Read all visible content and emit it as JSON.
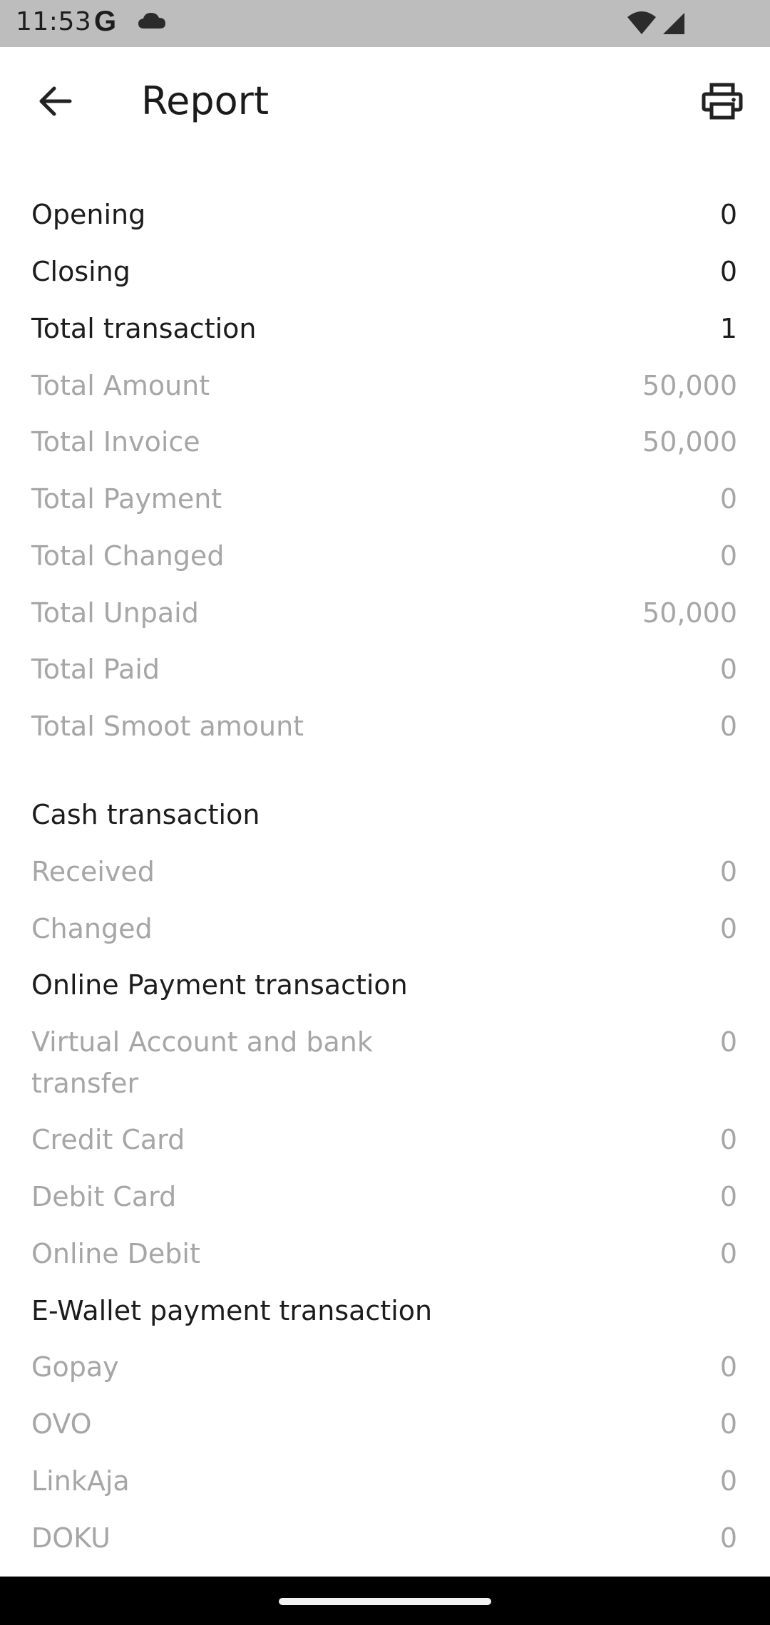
{
  "status": {
    "time": "11:53",
    "g": "G"
  },
  "header": {
    "title": "Report"
  },
  "summary": [
    {
      "label": "Opening",
      "value": "0",
      "style": "bold"
    },
    {
      "label": "Closing",
      "value": "0",
      "style": "bold"
    },
    {
      "label": "Total transaction",
      "value": "1",
      "style": "bold"
    },
    {
      "label": "Total Amount",
      "value": "50,000",
      "style": "muted"
    },
    {
      "label": "Total Invoice",
      "value": "50,000",
      "style": "muted"
    },
    {
      "label": "Total Payment",
      "value": "0",
      "style": "muted"
    },
    {
      "label": "Total Changed",
      "value": "0",
      "style": "muted"
    },
    {
      "label": "Total Unpaid",
      "value": "50,000",
      "style": "muted"
    },
    {
      "label": "Total Paid",
      "value": "0",
      "style": "muted"
    },
    {
      "label": "Total Smoot amount",
      "value": "0",
      "style": "muted"
    }
  ],
  "cash": {
    "title": "Cash transaction",
    "items": [
      {
        "label": "Received",
        "value": "0"
      },
      {
        "label": "Changed",
        "value": "0"
      }
    ]
  },
  "online": {
    "title": "Online Payment transaction",
    "items": [
      {
        "label": "Virtual Account and bank transfer",
        "value": "0"
      },
      {
        "label": "Credit Card",
        "value": "0"
      },
      {
        "label": "Debit Card",
        "value": "0"
      },
      {
        "label": "Online Debit",
        "value": "0"
      }
    ]
  },
  "ewallet": {
    "title": "E-Wallet payment transaction",
    "items": [
      {
        "label": "Gopay",
        "value": "0"
      },
      {
        "label": "OVO",
        "value": "0"
      },
      {
        "label": "LinkAja",
        "value": "0"
      },
      {
        "label": "DOKU",
        "value": "0"
      }
    ]
  }
}
